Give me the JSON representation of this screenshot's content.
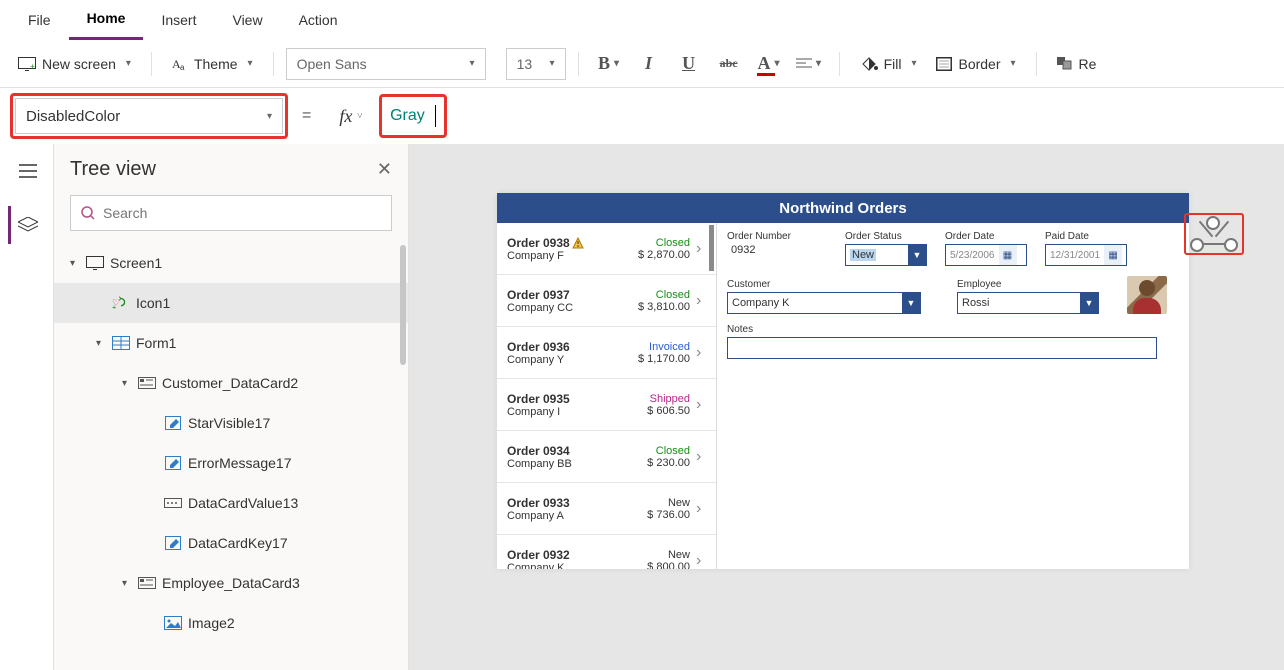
{
  "menubar": {
    "items": [
      {
        "label": "File"
      },
      {
        "label": "Home",
        "active": true
      },
      {
        "label": "Insert"
      },
      {
        "label": "View"
      },
      {
        "label": "Action"
      }
    ]
  },
  "toolbar": {
    "new_screen": "New screen",
    "theme": "Theme",
    "font": "Open Sans",
    "font_size": "13",
    "fill": "Fill",
    "border": "Border",
    "reorder": "Re"
  },
  "formula": {
    "property": "DisabledColor",
    "value": "Gray"
  },
  "treeview": {
    "title": "Tree view",
    "search_placeholder": "Search",
    "nodes": [
      {
        "label": "Screen1",
        "indent": 0,
        "type": "screen",
        "caret": true
      },
      {
        "label": "Icon1",
        "indent": 1,
        "type": "icon",
        "selected": true
      },
      {
        "label": "Form1",
        "indent": 1,
        "type": "form",
        "caret": true
      },
      {
        "label": "Customer_DataCard2",
        "indent": 2,
        "type": "card",
        "caret": true
      },
      {
        "label": "StarVisible17",
        "indent": 3,
        "type": "label"
      },
      {
        "label": "ErrorMessage17",
        "indent": 3,
        "type": "label"
      },
      {
        "label": "DataCardValue13",
        "indent": 3,
        "type": "input"
      },
      {
        "label": "DataCardKey17",
        "indent": 3,
        "type": "label"
      },
      {
        "label": "Employee_DataCard3",
        "indent": 2,
        "type": "card",
        "caret": true
      },
      {
        "label": "Image2",
        "indent": 3,
        "type": "image"
      }
    ]
  },
  "app": {
    "title": "Northwind Orders",
    "orders": [
      {
        "title": "Order 0938",
        "company": "Company F",
        "status": "Closed",
        "status_class": "closed",
        "amount": "$ 2,870.00",
        "warn": true
      },
      {
        "title": "Order 0937",
        "company": "Company CC",
        "status": "Closed",
        "status_class": "closed",
        "amount": "$ 3,810.00"
      },
      {
        "title": "Order 0936",
        "company": "Company Y",
        "status": "Invoiced",
        "status_class": "invoiced",
        "amount": "$ 1,170.00"
      },
      {
        "title": "Order 0935",
        "company": "Company I",
        "status": "Shipped",
        "status_class": "shipped",
        "amount": "$ 606.50"
      },
      {
        "title": "Order 0934",
        "company": "Company BB",
        "status": "Closed",
        "status_class": "closed",
        "amount": "$ 230.00"
      },
      {
        "title": "Order 0933",
        "company": "Company A",
        "status": "New",
        "status_class": "new",
        "amount": "$ 736.00"
      },
      {
        "title": "Order 0932",
        "company": "Company K",
        "status": "New",
        "status_class": "new",
        "amount": "$ 800.00"
      }
    ],
    "detail": {
      "order_number_label": "Order Number",
      "order_number": "0932",
      "order_status_label": "Order Status",
      "order_status": "New",
      "order_date_label": "Order Date",
      "order_date": "5/23/2006",
      "paid_date_label": "Paid Date",
      "paid_date": "12/31/2001",
      "customer_label": "Customer",
      "customer": "Company K",
      "employee_label": "Employee",
      "employee": "Rossi",
      "notes_label": "Notes"
    }
  }
}
